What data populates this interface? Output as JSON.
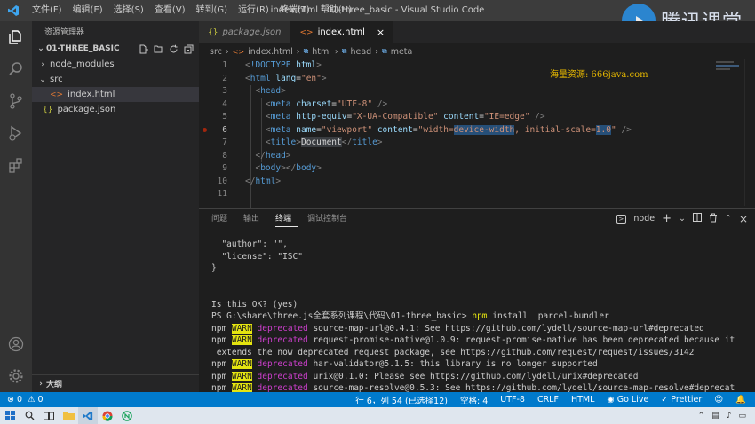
{
  "window": {
    "title": "index.html - 01-three_basic - Visual Studio Code",
    "menu": [
      "文件(F)",
      "编辑(E)",
      "选择(S)",
      "查看(V)",
      "转到(G)",
      "运行(R)",
      "终端(T)",
      "帮助(H)"
    ],
    "brand_text": "腾讯课堂"
  },
  "sidebar": {
    "header": "资源管理器",
    "folder": "01-THREE_BASIC",
    "items": [
      {
        "label": "node_modules",
        "kind": "folder"
      },
      {
        "label": "src",
        "kind": "folder"
      },
      {
        "label": "index.html",
        "kind": "html"
      },
      {
        "label": "package.json",
        "kind": "json"
      }
    ],
    "outline": "大纲"
  },
  "tabs": [
    {
      "label": "package.json",
      "active": false
    },
    {
      "label": "index.html",
      "active": true
    }
  ],
  "breadcrumb": [
    "src",
    "index.html",
    "html",
    "head",
    "meta"
  ],
  "editor": {
    "watermark": "海量资源: 666java.com",
    "current_line": 6
  },
  "panel": {
    "tabs": [
      "问题",
      "输出",
      "终端",
      "调试控制台"
    ],
    "active_tab": "终端",
    "terminal_name": "node",
    "lines": [
      "  \"author\": \"\",",
      "  \"license\": \"ISC\"",
      "}",
      "",
      "",
      "Is this OK? (yes)"
    ],
    "prompt": "PS G:\\share\\three.js全套系列课程\\代码\\01-three_basic> ",
    "command": "npm",
    "command_args": " install  parcel-bundler",
    "warn_lines": [
      {
        "pkg": " source-map-url@0.4.1: See https://github.com/lydell/source-map-url#deprecated",
        "cont": ""
      },
      {
        "pkg": " request-promise-native@1.0.9: request-promise-native has been deprecated because it",
        "cont": " extends the now deprecated request package, see https://github.com/request/request/issues/3142"
      },
      {
        "pkg": " har-validator@5.1.5: this library is no longer supported",
        "cont": ""
      },
      {
        "pkg": " urix@0.1.0: Please see https://github.com/lydell/urix#deprecated",
        "cont": ""
      },
      {
        "pkg": " source-map-resolve@0.5.3: See https://github.com/lydell/source-map-resolve#deprecat",
        "cont": ""
      }
    ],
    "npm_label": "npm",
    "warn_label": "WARN",
    "deprecated_label": "deprecated"
  },
  "statusbar": {
    "errors": "0",
    "warnings": "0",
    "position": "行 6，列 54 (已选择12)",
    "spaces": "空格: 4",
    "encoding": "UTF-8",
    "eol": "CRLF",
    "language": "HTML",
    "golive": "Go Live",
    "prettier": "Prettier"
  },
  "colors": {
    "accent": "#007acc",
    "warn_bg": "#e5e510",
    "deprecated": "#cd3fcd"
  }
}
